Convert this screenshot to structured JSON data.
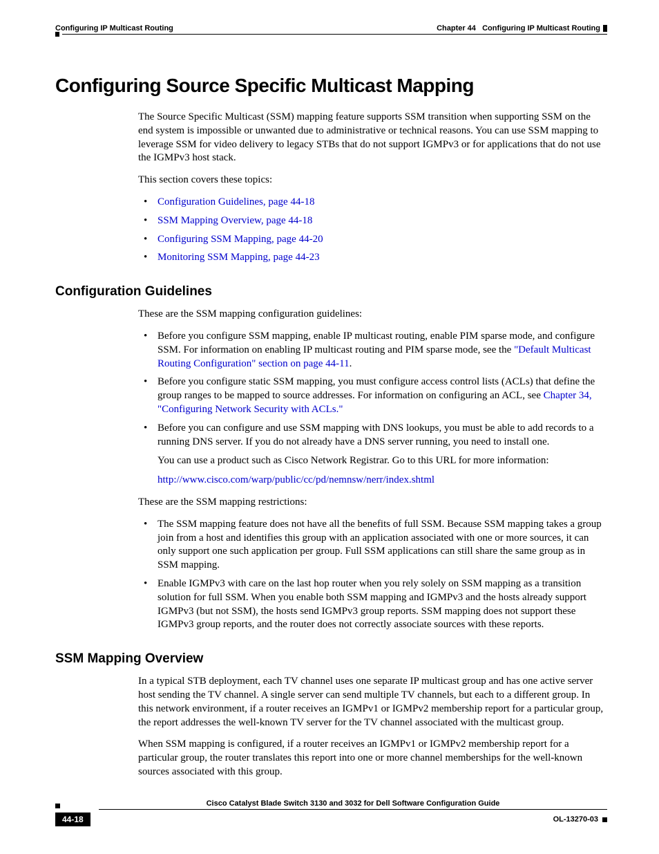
{
  "header": {
    "left": "Configuring IP Multicast Routing",
    "right_chapter": "Chapter 44",
    "right_title": "Configuring IP Multicast Routing"
  },
  "h1": "Configuring Source Specific Multicast Mapping",
  "intro_p1": "The Source Specific Multicast (SSM) mapping feature supports SSM transition when supporting SSM on the end system is impossible or unwanted due to administrative or technical reasons. You can use SSM mapping to leverage SSM for video delivery to legacy STBs that do not support IGMPv3 or for applications that do not use the IGMPv3 host stack.",
  "intro_p2": "This section covers these topics:",
  "topics": [
    "Configuration Guidelines, page 44-18",
    "SSM Mapping Overview, page 44-18",
    "Configuring SSM Mapping, page 44-20",
    "Monitoring SSM Mapping, page 44-23"
  ],
  "cg_heading": "Configuration Guidelines",
  "cg_intro": "These are the SSM mapping configuration guidelines:",
  "cg_b1_pre": "Before you configure SSM mapping, enable IP multicast routing, enable PIM sparse mode, and configure SSM. For information on enabling IP multicast routing and PIM sparse mode, see the ",
  "cg_b1_link": "\"Default Multicast Routing Configuration\" section on page 44-11",
  "cg_b1_post": ".",
  "cg_b2_pre": "Before you configure static SSM mapping, you must configure access control lists (ACLs) that define the group ranges to be mapped to source addresses. For information on configuring an ACL, see ",
  "cg_b2_link": "Chapter 34, \"Configuring Network Security with ACLs.\"",
  "cg_b3_p1": "Before you can configure and use SSM mapping with DNS lookups, you must be able to add records to a running DNS server. If you do not already have a DNS server running, you need to install one.",
  "cg_b3_p2": "You can use a product such as Cisco Network Registrar. Go to this URL for more information:",
  "cg_b3_url": "http://www.cisco.com/warp/public/cc/pd/nemnsw/nerr/index.shtml",
  "restrict_intro": "These are the SSM mapping restrictions:",
  "r_b1": "The SSM mapping feature does not have all the benefits of full SSM. Because SSM mapping takes a group join from a host and identifies this group with an application associated with one or more sources, it can only support one such application per group. Full SSM applications can still share the same group as in SSM mapping.",
  "r_b2": "Enable IGMPv3 with care on the last hop router when you rely solely on SSM mapping as a transition solution for full SSM. When you enable both SSM mapping and IGMPv3 and the hosts already support IGMPv3 (but not SSM), the hosts send IGMPv3 group reports. SSM mapping does not support these IGMPv3 group reports, and the router does not correctly associate sources with these reports.",
  "smo_heading": "SSM Mapping Overview",
  "smo_p1": "In a typical STB deployment, each TV channel uses one separate IP multicast group and has one active server host sending the TV channel. A single server can send multiple TV channels, but each to a different group. In this network environment, if a router receives an IGMPv1 or IGMPv2 membership report for a particular group, the report addresses the well-known TV server for the TV channel associated with the multicast group.",
  "smo_p2": "When SSM mapping is configured, if a router receives an IGMPv1 or IGMPv2 membership report for a particular group, the router translates this report into one or more channel memberships for the well-known sources associated with this group.",
  "footer": {
    "title": "Cisco Catalyst Blade Switch 3130 and 3032 for Dell Software Configuration Guide",
    "page": "44-18",
    "docid": "OL-13270-03"
  }
}
